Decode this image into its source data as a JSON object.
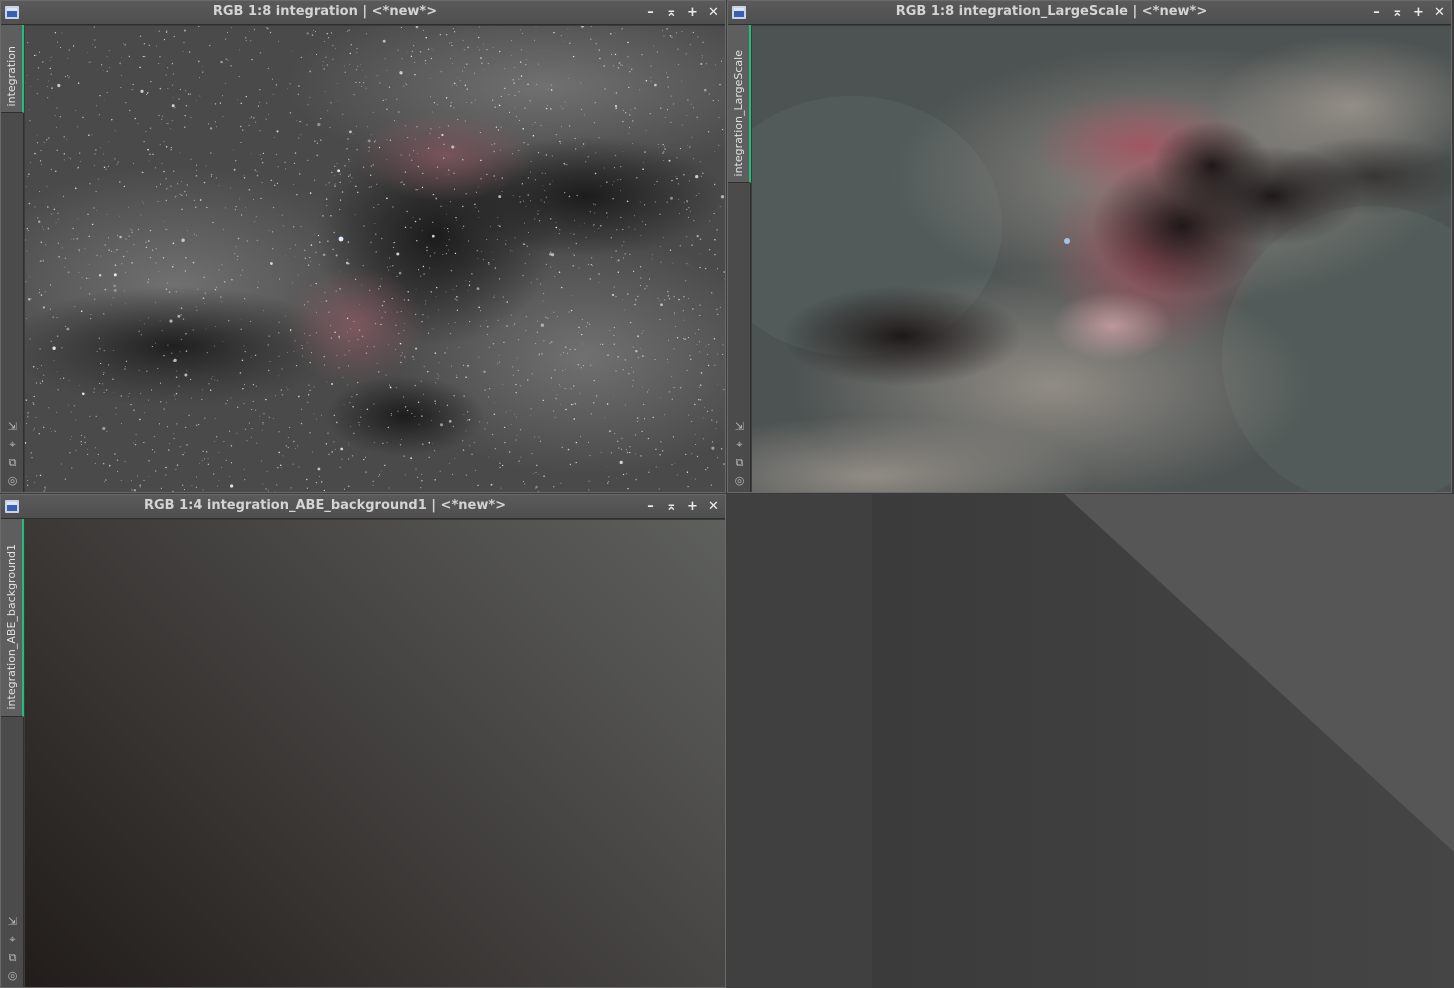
{
  "windows": [
    {
      "id": "integration",
      "title": "RGB 1:8 integration | <*new*>",
      "tab_label": "integration",
      "controls": {
        "minimize": "–",
        "shade": "⌅",
        "maximize": "+",
        "close": "✕"
      }
    },
    {
      "id": "integration_LargeScale",
      "title": "RGB 1:8 integration_LargeScale | <*new*>",
      "tab_label": "integration_LargeScale",
      "controls": {
        "minimize": "–",
        "shade": "⌅",
        "maximize": "+",
        "close": "✕"
      }
    },
    {
      "id": "integration_ABE_background1",
      "title": "RGB 1:4 integration_ABE_background1 | <*new*>",
      "tab_label": "integration_ABE_background1",
      "controls": {
        "minimize": "–",
        "shade": "⌅",
        "maximize": "+",
        "close": "✕"
      }
    }
  ],
  "side_tools": {
    "fit": "⇲",
    "zoom": "⌖",
    "clone": "⧉",
    "preview": "◎"
  },
  "icons": {
    "window": "image-window-icon",
    "minimize": "minimize-icon",
    "shade": "shade-icon",
    "maximize": "maximize-icon",
    "close": "close-icon"
  },
  "colors": {
    "titlebar": "#535353",
    "title_text": "#d4d4d4",
    "tab_accent": "#1fbf7a",
    "workspace": "#3b3b3b"
  }
}
